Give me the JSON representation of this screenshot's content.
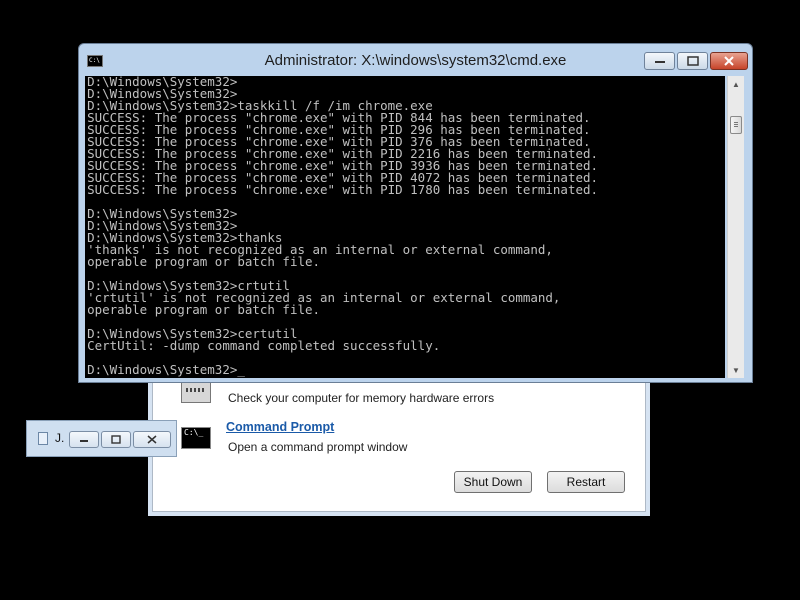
{
  "cmd_window": {
    "title": "Administrator: X:\\windows\\system32\\cmd.exe",
    "icon": "C:\\",
    "console_lines": [
      "D:\\Windows\\System32>",
      "D:\\Windows\\System32>",
      "D:\\Windows\\System32>taskkill /f /im chrome.exe",
      "SUCCESS: The process \"chrome.exe\" with PID 844 has been terminated.",
      "SUCCESS: The process \"chrome.exe\" with PID 296 has been terminated.",
      "SUCCESS: The process \"chrome.exe\" with PID 376 has been terminated.",
      "SUCCESS: The process \"chrome.exe\" with PID 2216 has been terminated.",
      "SUCCESS: The process \"chrome.exe\" with PID 3936 has been terminated.",
      "SUCCESS: The process \"chrome.exe\" with PID 4072 has been terminated.",
      "SUCCESS: The process \"chrome.exe\" with PID 1780 has been terminated.",
      "",
      "D:\\Windows\\System32>",
      "D:\\Windows\\System32>",
      "D:\\Windows\\System32>thanks",
      "'thanks' is not recognized as an internal or external command,",
      "operable program or batch file.",
      "",
      "D:\\Windows\\System32>crtutil",
      "'crtutil' is not recognized as an internal or external command,",
      "operable program or batch file.",
      "",
      "D:\\Windows\\System32>certutil",
      "CertUtil: -dump command completed successfully.",
      "",
      "D:\\Windows\\System32>_"
    ]
  },
  "recovery": {
    "memory_description": "Check your computer for memory hardware errors",
    "command_prompt_link": "Command Prompt",
    "command_prompt_description": "Open a command prompt window",
    "cmd_icon_text": "C:\\_",
    "shutdown_label": "Shut Down",
    "restart_label": "Restart"
  },
  "mini_window": {
    "title": "J."
  },
  "icons": {
    "cmd": "cmd-icon",
    "memory": "memory-icon",
    "minimize": "minimize-icon",
    "maximize": "maximize-icon",
    "close": "close-icon"
  }
}
